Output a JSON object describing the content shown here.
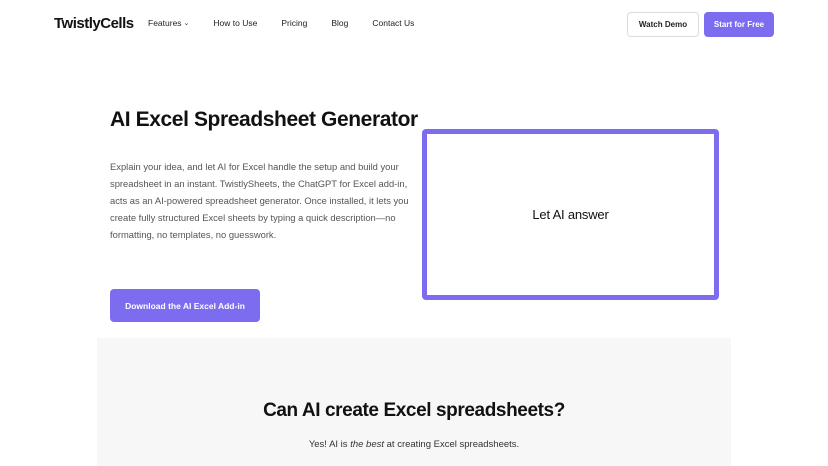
{
  "header": {
    "logo": "TwistlyCells",
    "nav": [
      {
        "label": "Features",
        "dropdown": true
      },
      {
        "label": "How to Use"
      },
      {
        "label": "Pricing"
      },
      {
        "label": "Blog"
      },
      {
        "label": "Contact Us"
      }
    ],
    "watch_demo": "Watch Demo",
    "start_free": "Start for Free"
  },
  "hero": {
    "title": "AI Excel Spreadsheet Generator",
    "description": "Explain your idea, and let AI for Excel handle the setup and build your spreadsheet in an instant. TwistlySheets, the ChatGPT for Excel add-in, acts as an AI-powered spreadsheet generator. Once installed, it lets you create fully structured Excel sheets by typing a quick description—no formatting, no templates, no guesswork.",
    "download_button": "Download the AI Excel Add-in",
    "demo_box_text": "Let AI answer"
  },
  "faq_section": {
    "title": "Can AI create Excel spreadsheets?",
    "subtitle_prefix": "Yes! AI is ",
    "subtitle_emphasis": "the best",
    "subtitle_suffix": " at creating Excel spreadsheets."
  },
  "colors": {
    "accent": "#7b6cf0",
    "section_bg": "#f7f7f7"
  }
}
